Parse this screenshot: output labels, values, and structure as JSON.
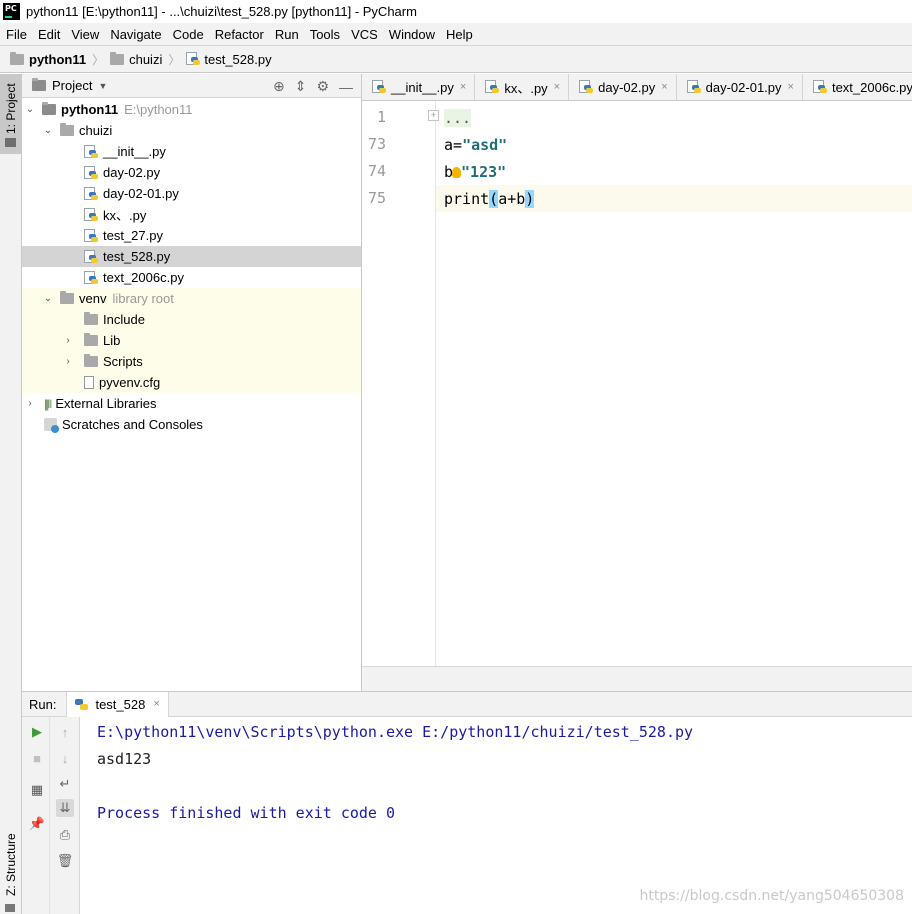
{
  "window": {
    "title": "python11 [E:\\python11] - ...\\chuizi\\test_528.py [python11] - PyCharm",
    "logo_text": "PC"
  },
  "menu": [
    "File",
    "Edit",
    "View",
    "Navigate",
    "Code",
    "Refactor",
    "Run",
    "Tools",
    "VCS",
    "Window",
    "Help"
  ],
  "breadcrumb": {
    "project": "python11",
    "folder": "chuizi",
    "file": "test_528.py"
  },
  "left_strip": {
    "project_tab": "1: Project",
    "structure_tab": "Z: Structure"
  },
  "project_panel": {
    "title": "Project",
    "tree": {
      "root": {
        "name": "python11",
        "path": "E:\\python11"
      },
      "chuizi": "chuizi",
      "files": [
        "__init__.py",
        "day-02.py",
        "day-02-01.py",
        "kx、.py",
        "test_27.py",
        "test_528.py",
        "text_2006c.py"
      ],
      "venv": {
        "name": "venv",
        "hint": "library root"
      },
      "venv_children": [
        "Include",
        "Lib",
        "Scripts",
        "pyvenv.cfg"
      ],
      "external": "External Libraries",
      "scratches": "Scratches and Consoles"
    }
  },
  "editor": {
    "tabs": [
      "__init__.py",
      "kx、.py",
      "day-02.py",
      "day-02-01.py",
      "text_2006c.py"
    ],
    "line_numbers": [
      "1",
      "73",
      "74",
      "75"
    ],
    "lines": {
      "l1": "...",
      "l73_var": "a=",
      "l73_str": "\"asd\"",
      "l74_var": "b",
      "l74_eq": "=",
      "l74_str": "\"123\"",
      "l75_fn": "print",
      "l75_open": "(",
      "l75_args": "a+b",
      "l75_close": ")"
    }
  },
  "run": {
    "label": "Run:",
    "tab": "test_528",
    "console": [
      "E:\\python11\\venv\\Scripts\\python.exe E:/python11/chuizi/test_528.py",
      "asd123",
      "",
      "Process finished with exit code 0"
    ]
  },
  "watermark": "https://blog.csdn.net/yang504650308"
}
